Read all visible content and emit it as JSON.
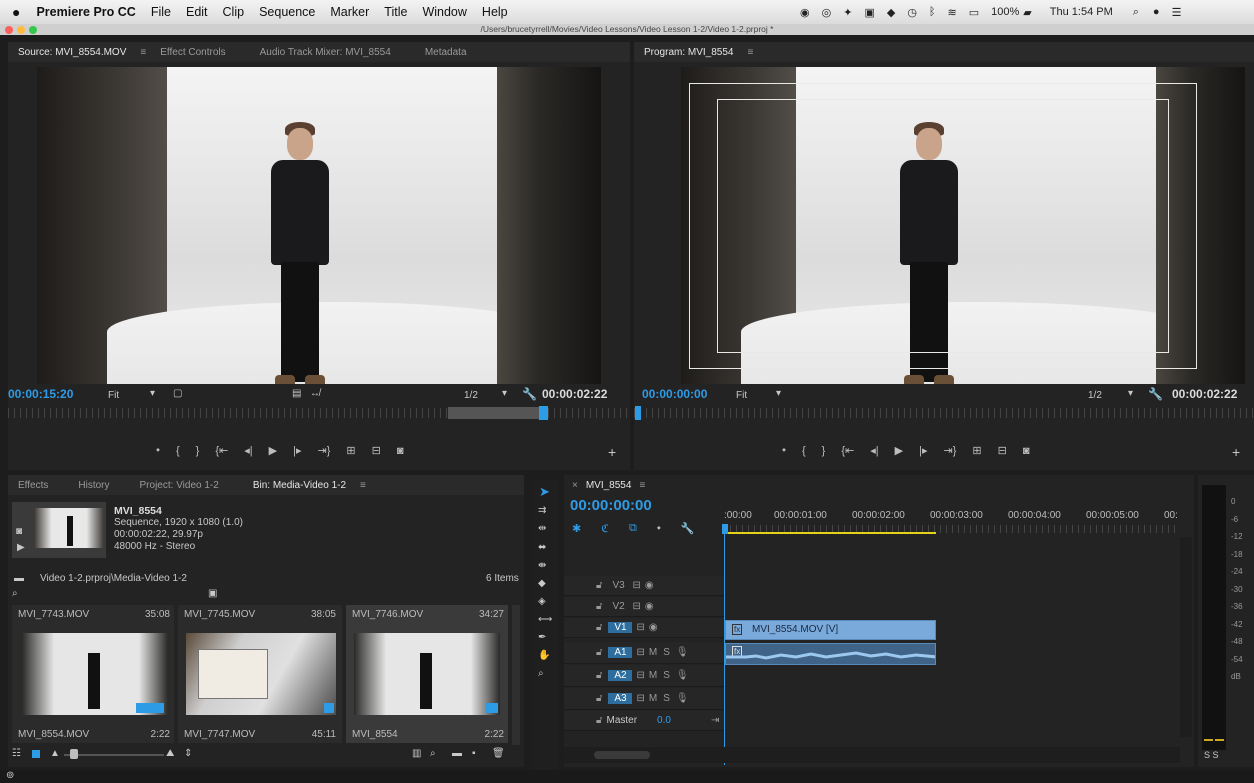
{
  "menubar": {
    "apple": "",
    "app": "Premiere Pro CC",
    "items": [
      "File",
      "Edit",
      "Clip",
      "Sequence",
      "Marker",
      "Title",
      "Window",
      "Help"
    ],
    "battery": "100%",
    "clock": "Thu 1:54 PM"
  },
  "window": {
    "path": "/Users/brucetyrrell/Movies/Video Lessons/Video Lesson 1-2/Video 1-2.prproj *"
  },
  "source": {
    "tabs": [
      "Source: MVI_8554.MOV",
      "Effect Controls",
      "Audio Track Mixer: MVI_8554",
      "Metadata"
    ],
    "timecode": "00:00:15:20",
    "fit": "Fit",
    "resolution": "1/2",
    "duration": "00:00:02:22"
  },
  "program": {
    "tab": "Program: MVI_8554",
    "timecode": "00:00:00:00",
    "fit": "Fit",
    "resolution": "1/2",
    "duration": "00:00:02:22"
  },
  "bin": {
    "tabs": [
      "Effects",
      "History",
      "Project: Video 1-2",
      "Bin: Media-Video 1-2"
    ],
    "preview": {
      "name": "MVI_8554",
      "line1": "Sequence, 1920 x 1080 (1.0)",
      "line2": "00:00:02:22, 29.97p",
      "line3": "48000 Hz - Stereo"
    },
    "path": "Video 1-2.prproj\\Media-Video 1-2",
    "count": "6 Items",
    "items": [
      {
        "name": "MVI_7743.MOV",
        "dur": "35:08"
      },
      {
        "name": "MVI_7745.MOV",
        "dur": "38:05"
      },
      {
        "name": "MVI_7746.MOV",
        "dur": "34:27"
      },
      {
        "name": "MVI_8554.MOV",
        "dur": "2:22"
      },
      {
        "name": "MVI_7747.MOV",
        "dur": "45:11"
      },
      {
        "name": "MVI_8554",
        "dur": "2:22"
      }
    ]
  },
  "timeline": {
    "tab": "MVI_8554",
    "timecode": "00:00:00:00",
    "ruler": [
      ":00:00",
      "00:00:01:00",
      "00:00:02:00",
      "00:00:03:00",
      "00:00:04:00",
      "00:00:05:00",
      "00:"
    ],
    "tracks": [
      "V3",
      "V2",
      "V1",
      "A1",
      "A2",
      "A3"
    ],
    "mute": "M",
    "solo": "S",
    "master": "Master",
    "master_val": "0.0",
    "clip_v": "MVI_8554.MOV [V]",
    "fx": "fx"
  },
  "meter": {
    "labels": [
      "0",
      "-6",
      "-12",
      "-18",
      "-24",
      "-30",
      "-36",
      "-42",
      "-48",
      "-54",
      "dB"
    ],
    "solo": "S  S"
  }
}
